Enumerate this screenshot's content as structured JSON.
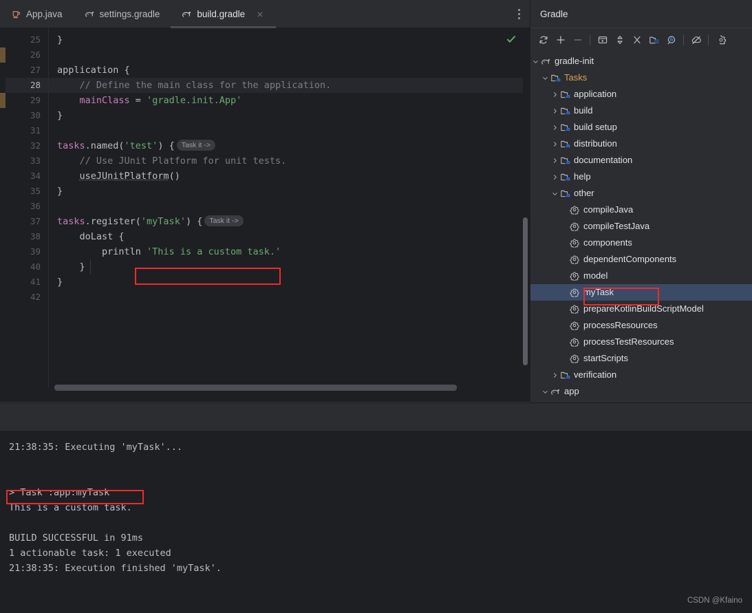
{
  "colors": {
    "accent_red": "#ee2b2b",
    "selection_blue": "#3b4a66",
    "tasks_node_orange": "#d9a05b",
    "string_green": "#6aab73",
    "keyword_purple": "#c77dbb",
    "comment_gray": "#7a7e85",
    "editor_bg": "#1e1f22",
    "panel_bg": "#2b2d30",
    "change_marker": "#6a5434",
    "check_green": "#5fad65"
  },
  "editor_tabs": {
    "tabs": [
      {
        "label": "App.java",
        "icon": "java-class-icon",
        "active": false,
        "closable": false
      },
      {
        "label": "settings.gradle",
        "icon": "gradle-elephant-icon",
        "active": false,
        "closable": false
      },
      {
        "label": "build.gradle",
        "icon": "gradle-elephant-icon",
        "active": true,
        "closable": true
      }
    ],
    "overflow_menu": "more-options-icon",
    "close_glyph": "×"
  },
  "editor": {
    "inspection_status": "ok-checkmark",
    "current_line": 28,
    "first_line": 25,
    "lines": [
      {
        "n": 25,
        "tokens": [
          {
            "t": "}",
            "c": "plain"
          }
        ]
      },
      {
        "n": 26,
        "tokens": []
      },
      {
        "n": 27,
        "tokens": [
          {
            "t": "application {",
            "c": "plain"
          }
        ]
      },
      {
        "n": 28,
        "tokens": [
          {
            "t": "    // Define the main class for the application.",
            "c": "cmt"
          }
        ]
      },
      {
        "n": 29,
        "tokens": [
          {
            "t": "    ",
            "c": "plain"
          },
          {
            "t": "mainClass",
            "c": "prop"
          },
          {
            "t": " = ",
            "c": "plain"
          },
          {
            "t": "'gradle.init.App'",
            "c": "str"
          }
        ]
      },
      {
        "n": 30,
        "tokens": [
          {
            "t": "}",
            "c": "plain"
          }
        ]
      },
      {
        "n": 31,
        "tokens": []
      },
      {
        "n": 32,
        "tokens": [
          {
            "t": "tasks",
            "c": "kw"
          },
          {
            "t": ".named(",
            "c": "plain"
          },
          {
            "t": "'test'",
            "c": "str"
          },
          {
            "t": ") {",
            "c": "plain"
          },
          {
            "t": "Task it ->",
            "c": "hint"
          }
        ]
      },
      {
        "n": 33,
        "tokens": [
          {
            "t": "    // Use JUnit Platform for unit tests.",
            "c": "cmt"
          }
        ]
      },
      {
        "n": 34,
        "tokens": [
          {
            "t": "    ",
            "c": "plain"
          },
          {
            "t": "useJUnitPlatform",
            "c": "under"
          },
          {
            "t": "()",
            "c": "plain"
          }
        ]
      },
      {
        "n": 35,
        "tokens": [
          {
            "t": "}",
            "c": "plain"
          }
        ]
      },
      {
        "n": 36,
        "tokens": []
      },
      {
        "n": 37,
        "tokens": [
          {
            "t": "tasks",
            "c": "kw"
          },
          {
            "t": ".register(",
            "c": "plain"
          },
          {
            "t": "'myTask'",
            "c": "str"
          },
          {
            "t": ") {",
            "c": "plain"
          },
          {
            "t": "Task it ->",
            "c": "hint"
          }
        ]
      },
      {
        "n": 38,
        "tokens": [
          {
            "t": "    doLast {",
            "c": "plain"
          }
        ]
      },
      {
        "n": 39,
        "tokens": [
          {
            "t": "        println ",
            "c": "plain"
          },
          {
            "t": "'This is a custom task.'",
            "c": "str"
          }
        ]
      },
      {
        "n": 40,
        "tokens": [
          {
            "t": "    }",
            "c": "plain"
          }
        ]
      },
      {
        "n": 41,
        "tokens": [
          {
            "t": "}",
            "c": "plain"
          }
        ]
      },
      {
        "n": 42,
        "tokens": []
      }
    ],
    "highlighted_snippet": "'This is a custom task.'"
  },
  "gradle_panel": {
    "title": "Gradle",
    "toolbar": [
      {
        "name": "reload-all-gradle-projects-icon"
      },
      {
        "name": "link-gradle-project-icon"
      },
      {
        "name": "detach-external-project-icon"
      },
      {
        "name": "separator"
      },
      {
        "name": "run-task-icon"
      },
      {
        "name": "expand-collapse-icon"
      },
      {
        "name": "collapse-all-icon"
      },
      {
        "name": "attach-gradle-project-icon"
      },
      {
        "name": "execute-gradle-task-icon"
      },
      {
        "name": "separator"
      },
      {
        "name": "toggle-offline-mode-icon"
      },
      {
        "name": "separator"
      },
      {
        "name": "gradle-settings-icon"
      }
    ],
    "tree": [
      {
        "label": "gradle-init",
        "depth": 0,
        "arrow": "down",
        "icon": "gradle-elephant-icon",
        "style": "project",
        "selected": false
      },
      {
        "label": "Tasks",
        "depth": 1,
        "arrow": "down",
        "icon": "task-folder-icon",
        "style": "tasks",
        "selected": false
      },
      {
        "label": "application",
        "depth": 2,
        "arrow": "right",
        "icon": "task-folder-icon",
        "style": "normal",
        "selected": false
      },
      {
        "label": "build",
        "depth": 2,
        "arrow": "right",
        "icon": "task-folder-icon",
        "style": "normal",
        "selected": false
      },
      {
        "label": "build setup",
        "depth": 2,
        "arrow": "right",
        "icon": "task-folder-icon",
        "style": "normal",
        "selected": false
      },
      {
        "label": "distribution",
        "depth": 2,
        "arrow": "right",
        "icon": "task-folder-icon",
        "style": "normal",
        "selected": false
      },
      {
        "label": "documentation",
        "depth": 2,
        "arrow": "right",
        "icon": "task-folder-icon",
        "style": "normal",
        "selected": false
      },
      {
        "label": "help",
        "depth": 2,
        "arrow": "right",
        "icon": "task-folder-icon",
        "style": "normal",
        "selected": false
      },
      {
        "label": "other",
        "depth": 2,
        "arrow": "down",
        "icon": "task-folder-icon",
        "style": "normal",
        "selected": false
      },
      {
        "label": "compileJava",
        "depth": 3,
        "arrow": "none",
        "icon": "gradle-task-gear-icon",
        "style": "normal",
        "selected": false
      },
      {
        "label": "compileTestJava",
        "depth": 3,
        "arrow": "none",
        "icon": "gradle-task-gear-icon",
        "style": "normal",
        "selected": false
      },
      {
        "label": "components",
        "depth": 3,
        "arrow": "none",
        "icon": "gradle-task-gear-icon",
        "style": "normal",
        "selected": false
      },
      {
        "label": "dependentComponents",
        "depth": 3,
        "arrow": "none",
        "icon": "gradle-task-gear-icon",
        "style": "normal",
        "selected": false
      },
      {
        "label": "model",
        "depth": 3,
        "arrow": "none",
        "icon": "gradle-task-gear-icon",
        "style": "normal",
        "selected": false
      },
      {
        "label": "myTask",
        "depth": 3,
        "arrow": "none",
        "icon": "gradle-task-gear-icon",
        "style": "normal",
        "selected": true
      },
      {
        "label": "prepareKotlinBuildScriptModel",
        "depth": 3,
        "arrow": "none",
        "icon": "gradle-task-gear-icon",
        "style": "normal",
        "selected": false
      },
      {
        "label": "processResources",
        "depth": 3,
        "arrow": "none",
        "icon": "gradle-task-gear-icon",
        "style": "normal",
        "selected": false
      },
      {
        "label": "processTestResources",
        "depth": 3,
        "arrow": "none",
        "icon": "gradle-task-gear-icon",
        "style": "normal",
        "selected": false
      },
      {
        "label": "startScripts",
        "depth": 3,
        "arrow": "none",
        "icon": "gradle-task-gear-icon",
        "style": "normal",
        "selected": false
      },
      {
        "label": "verification",
        "depth": 2,
        "arrow": "right",
        "icon": "task-folder-icon",
        "style": "normal",
        "selected": false
      },
      {
        "label": "app",
        "depth": 1,
        "arrow": "down",
        "icon": "gradle-elephant-icon",
        "style": "project",
        "selected": false
      }
    ],
    "selected_item": "myTask"
  },
  "console": {
    "lines": [
      "21:38:35: Executing 'myTask'...",
      "",
      "",
      "> Task :app:myTask",
      "This is a custom task.",
      "",
      "BUILD SUCCESSFUL in 91ms",
      "1 actionable task: 1 executed",
      "21:38:35: Execution finished 'myTask'."
    ],
    "highlighted_line": "This is a custom task."
  },
  "watermark": "CSDN @Kfaino"
}
